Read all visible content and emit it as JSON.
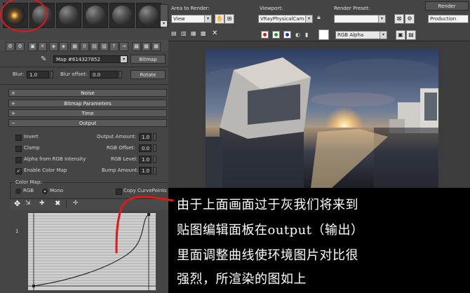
{
  "material_editor": {
    "map_name": "Map #614327852",
    "map_type": "Bitmap",
    "blur_label": "Blur:",
    "blur_value": "1.0",
    "blur_offset_label": "Blur offset:",
    "blur_offset_value": "0.0",
    "rotate_label": "Rotate",
    "rollouts": [
      "Noise",
      "Bitmap Parameters",
      "Time",
      "Output"
    ],
    "output": {
      "invert_label": "Invert",
      "clamp_label": "Clamp",
      "alpha_label": "Alpha from RGB Intensity",
      "enable_color_map_label": "Enable Color Map",
      "enable_color_map_checked": true,
      "output_amount_label": "Output Amount:",
      "output_amount": "1.0",
      "rgb_offset_label": "RGB Offset:",
      "rgb_offset": "0.0",
      "rgb_level_label": "RGB Level:",
      "rgb_level": "1.0",
      "bump_amount_label": "Bump Amount:",
      "bump_amount": "1.0"
    },
    "color_map": {
      "group_label": "Color Map:",
      "rgb_label": "RGB",
      "mono_label": "Mono",
      "mono_selected": true,
      "copy_curve_label": "Copy CurvePoints",
      "y_axis_label": "1"
    }
  },
  "render_window": {
    "area_to_render_label": "Area to Render:",
    "area_to_render_value": "View",
    "viewport_label": "Viewport:",
    "viewport_value": "VRayPhysicalCam",
    "render_preset_label": "Render Preset:",
    "render_preset_value": "",
    "render_button_label": "Render",
    "production_value": "Production",
    "channel_value": "RGB Alpha",
    "channel_colors": [
      "#e01010",
      "#10a010",
      "#1030e0"
    ]
  },
  "caption": {
    "lines": [
      "由于上面画面过于灰我们将来到",
      "贴图编辑面板在output（输出）",
      "里面调整曲线使环境图片对比很",
      "强烈，所渲染的图如上"
    ]
  },
  "highlight_color": "#e01818"
}
